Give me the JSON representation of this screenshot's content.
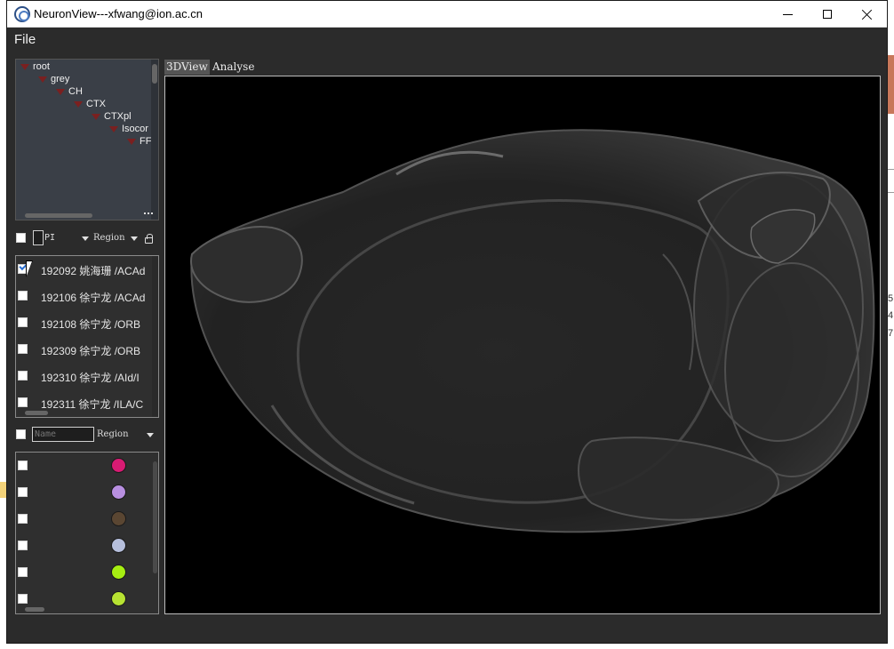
{
  "window": {
    "title": "NeuronView---xfwang@ion.ac.cn"
  },
  "menu": {
    "file": "File"
  },
  "tree": {
    "items": [
      {
        "label": "root"
      },
      {
        "label": "grey"
      },
      {
        "label": "CH"
      },
      {
        "label": "CTX"
      },
      {
        "label": "CTXpl"
      },
      {
        "label": "Isocor"
      },
      {
        "label": "FF"
      }
    ]
  },
  "neuron_filter": {
    "pi_value": "PI",
    "region_combo": "Region"
  },
  "neurons": [
    {
      "text": "192092  姚海珊  /ACAd",
      "checked": true
    },
    {
      "text": "192106  徐宁龙  /ACAd",
      "checked": false
    },
    {
      "text": "192108  徐宁龙  /ORB",
      "checked": false
    },
    {
      "text": "192309  徐宁龙  /ORB",
      "checked": false
    },
    {
      "text": "192310  徐宁龙  /AId/I",
      "checked": false
    },
    {
      "text": "192311  徐宁龙  /ILA/C",
      "checked": false
    }
  ],
  "region_filter": {
    "name_placeholder": "Name",
    "region_combo": "Region"
  },
  "region_colors": [
    "#d81b73",
    "#b88fe0",
    "#5a4632",
    "#b6bfdc",
    "#a6ee12",
    "#b7e232"
  ],
  "tabs": {
    "view3d": "3DView",
    "analyse": "Analyse"
  },
  "desktop": {
    "edge_chars": [
      "5",
      "4",
      "7"
    ]
  }
}
